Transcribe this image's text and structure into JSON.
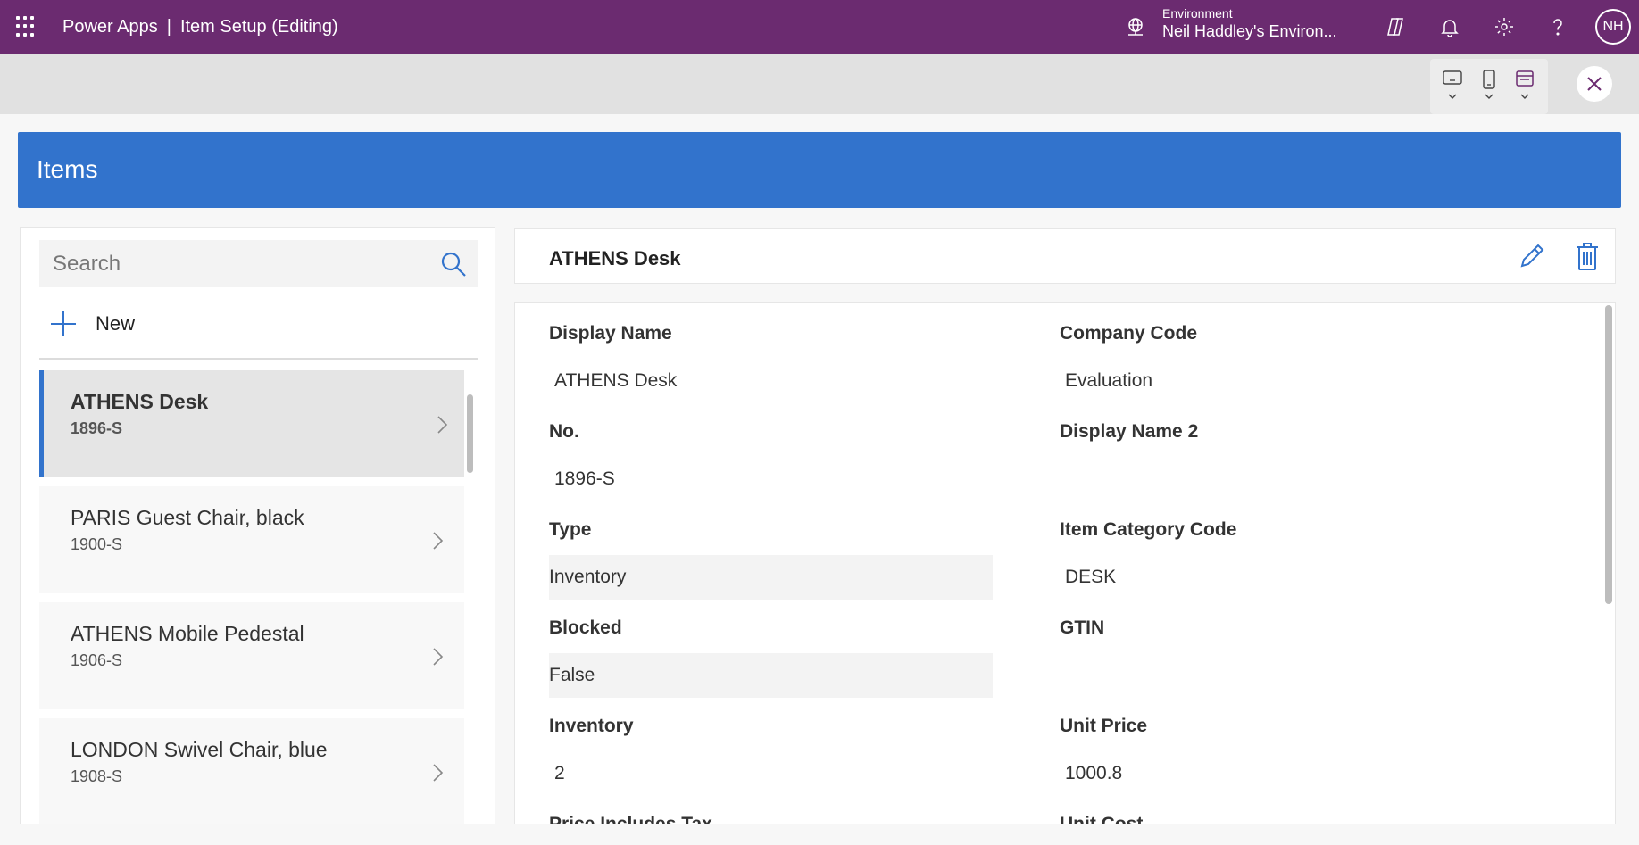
{
  "topbar": {
    "app_name": "Power Apps",
    "separator": "|",
    "screen_title": "Item Setup (Editing)",
    "env_label": "Environment",
    "env_name": "Neil Haddley's Environ...",
    "avatar_initials": "NH",
    "bg_color": "#6b2b70"
  },
  "header": {
    "title": "Items",
    "bg_color": "#3273cc"
  },
  "search": {
    "placeholder": "Search",
    "value": ""
  },
  "new_button": {
    "label": "New"
  },
  "items": [
    {
      "name": "ATHENS Desk",
      "code": "1896-S",
      "selected": true
    },
    {
      "name": "PARIS Guest Chair, black",
      "code": "1900-S",
      "selected": false
    },
    {
      "name": "ATHENS Mobile Pedestal",
      "code": "1906-S",
      "selected": false
    },
    {
      "name": "LONDON Swivel Chair, blue",
      "code": "1908-S",
      "selected": false
    }
  ],
  "detail": {
    "title": "ATHENS Desk",
    "fields": {
      "display_name": {
        "label": "Display Name",
        "value": "ATHENS Desk"
      },
      "company_code": {
        "label": "Company Code",
        "value": "Evaluation"
      },
      "no": {
        "label": "No.",
        "value": "1896-S"
      },
      "display_name_2": {
        "label": "Display Name 2",
        "value": ""
      },
      "type": {
        "label": "Type",
        "value": "Inventory"
      },
      "item_category_code": {
        "label": "Item Category Code",
        "value": "DESK"
      },
      "blocked": {
        "label": "Blocked",
        "value": "False"
      },
      "gtin": {
        "label": "GTIN",
        "value": ""
      },
      "inventory": {
        "label": "Inventory",
        "value": "2"
      },
      "unit_price": {
        "label": "Unit Price",
        "value": "1000.8"
      },
      "price_includes_tax": {
        "label": "Price Includes Tax",
        "value": ""
      },
      "unit_cost": {
        "label": "Unit Cost",
        "value": ""
      }
    }
  }
}
